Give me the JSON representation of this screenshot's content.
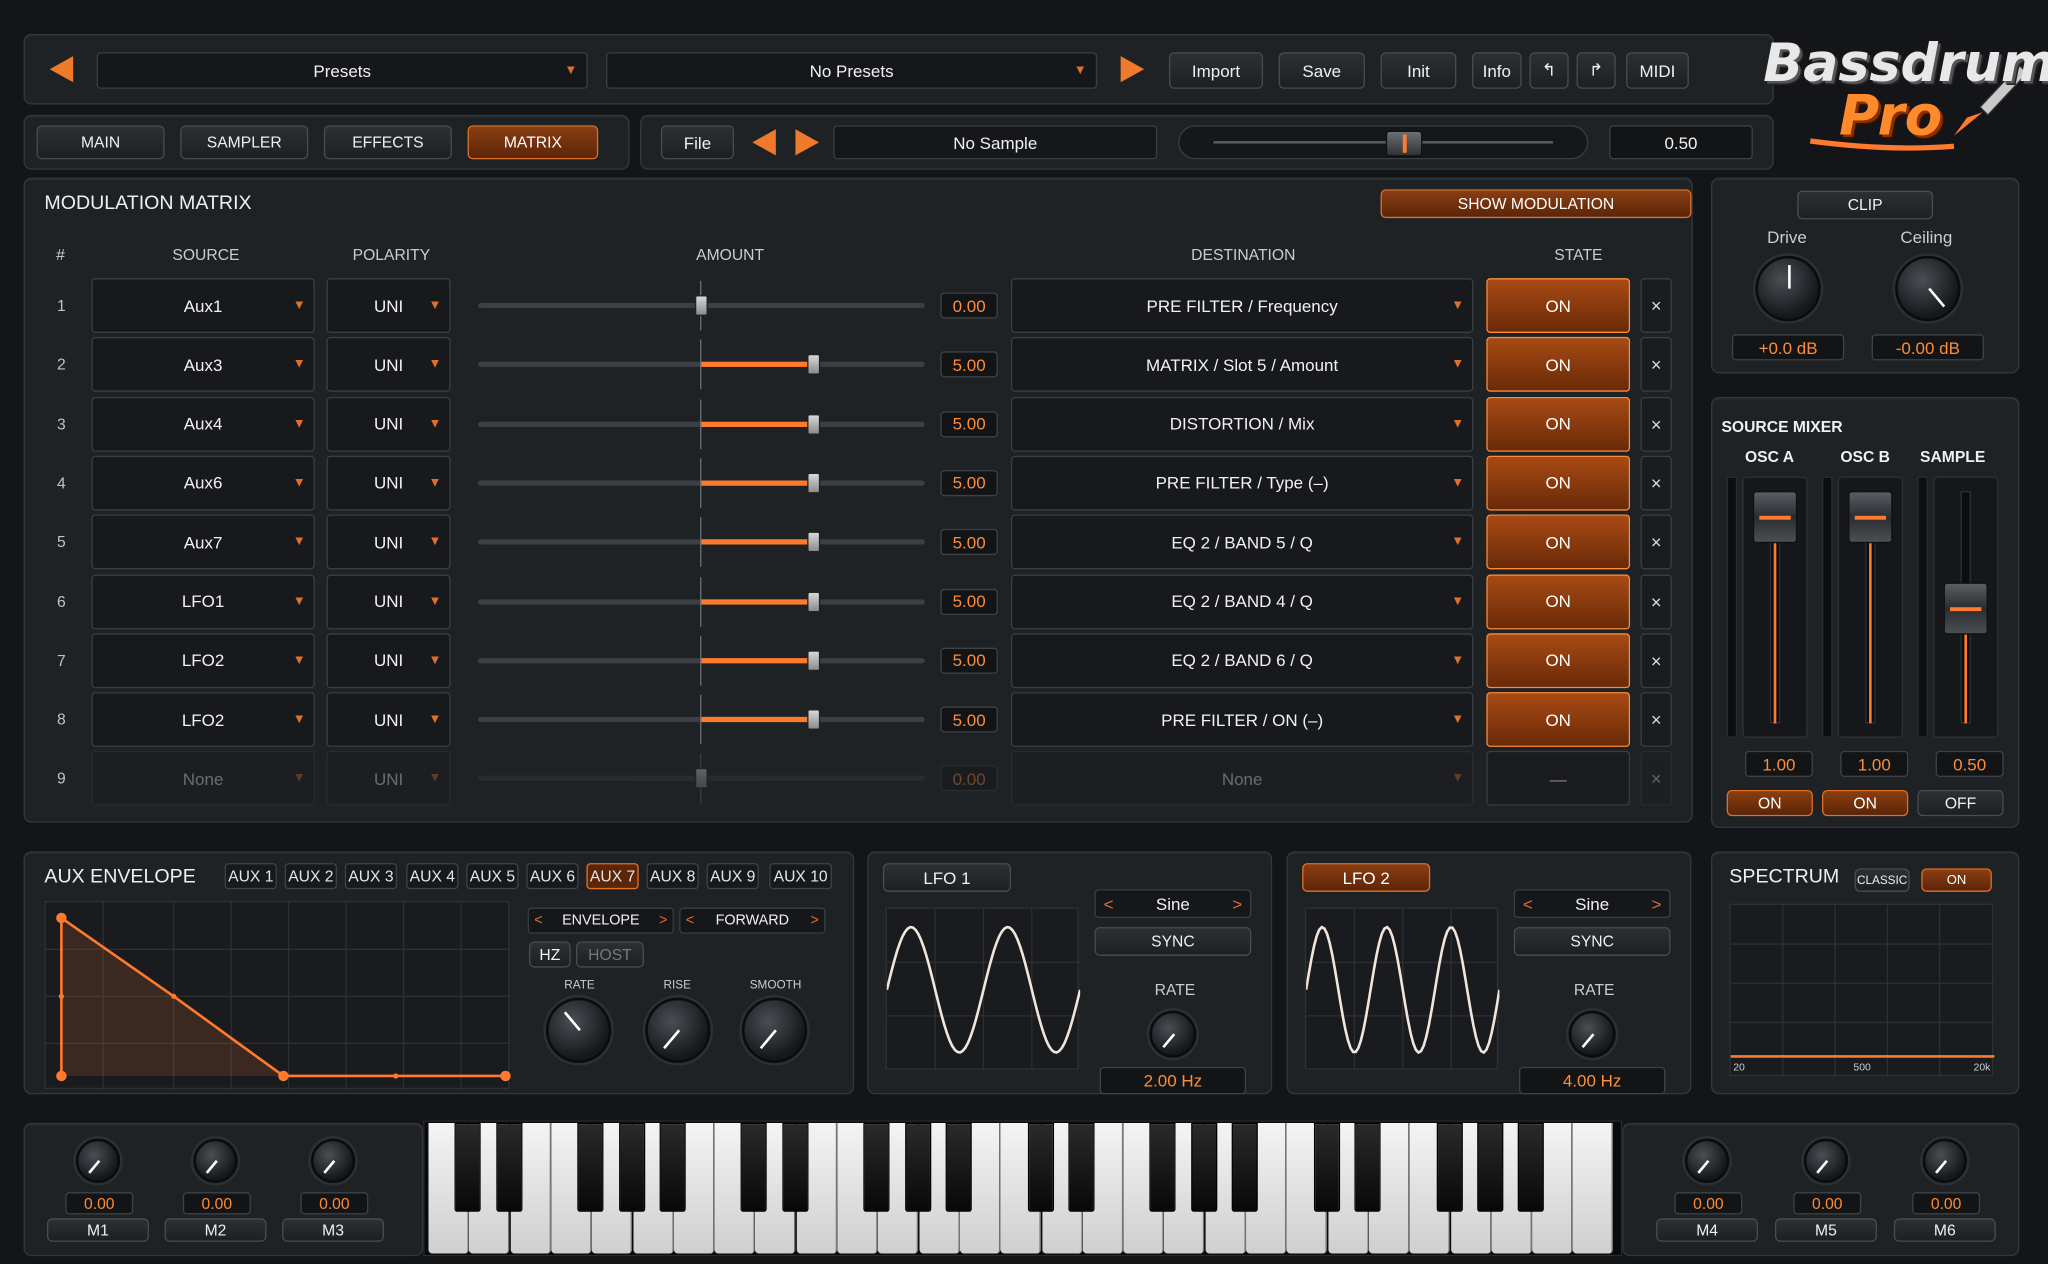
{
  "colors": {
    "accent": "#ff7a2c",
    "panel": "#1f2225",
    "background": "#131518"
  },
  "topbar": {
    "presets_dropdown": "Presets",
    "presets_list": "No Presets",
    "import": "Import",
    "save": "Save",
    "init": "Init",
    "info": "Info",
    "undo_icon": "↰",
    "redo_icon": "↱",
    "midi": "MIDI"
  },
  "logo": {
    "line1": "Bassdrum",
    "line2": "Pro"
  },
  "tabs": [
    "MAIN",
    "SAMPLER",
    "EFFECTS",
    "MATRIX"
  ],
  "active_tab": "MATRIX",
  "sample_bar": {
    "file": "File",
    "sample_name": "No Sample",
    "value": "0.50",
    "slider_value": 0.5
  },
  "matrix": {
    "title": "MODULATION MATRIX",
    "show_modulation": "SHOW MODULATION",
    "headers": {
      "num": "#",
      "source": "SOURCE",
      "polarity": "POLARITY",
      "amount": "AMOUNT",
      "destination": "DESTINATION",
      "state": "STATE"
    },
    "close_icon": "×",
    "rows": [
      {
        "num": "1",
        "source": "Aux1",
        "polarity": "UNI",
        "amount": "0.00",
        "amount_value": 0.0,
        "destination": "PRE FILTER / Frequency",
        "state": "ON"
      },
      {
        "num": "2",
        "source": "Aux3",
        "polarity": "UNI",
        "amount": "5.00",
        "amount_value": 5.0,
        "destination": "MATRIX / Slot 5 / Amount",
        "state": "ON"
      },
      {
        "num": "3",
        "source": "Aux4",
        "polarity": "UNI",
        "amount": "5.00",
        "amount_value": 5.0,
        "destination": "DISTORTION / Mix",
        "state": "ON"
      },
      {
        "num": "4",
        "source": "Aux6",
        "polarity": "UNI",
        "amount": "5.00",
        "amount_value": 5.0,
        "destination": "PRE FILTER / Type (–)",
        "state": "ON"
      },
      {
        "num": "5",
        "source": "Aux7",
        "polarity": "UNI",
        "amount": "5.00",
        "amount_value": 5.0,
        "destination": "EQ 2 / BAND 5 / Q",
        "state": "ON"
      },
      {
        "num": "6",
        "source": "LFO1",
        "polarity": "UNI",
        "amount": "5.00",
        "amount_value": 5.0,
        "destination": "EQ 2 / BAND 4 / Q",
        "state": "ON"
      },
      {
        "num": "7",
        "source": "LFO2",
        "polarity": "UNI",
        "amount": "5.00",
        "amount_value": 5.0,
        "destination": "EQ 2 / BAND 6 / Q",
        "state": "ON"
      },
      {
        "num": "8",
        "source": "LFO2",
        "polarity": "UNI",
        "amount": "5.00",
        "amount_value": 5.0,
        "destination": "PRE FILTER / ON (–)",
        "state": "ON"
      },
      {
        "num": "9",
        "source": "None",
        "polarity": "UNI",
        "amount": "0.00",
        "amount_value": 0.0,
        "destination": "None",
        "state": "—"
      }
    ]
  },
  "clip": {
    "title": "CLIP",
    "drive_label": "Drive",
    "ceiling_label": "Ceiling",
    "drive_value": "+0.0 dB",
    "ceiling_value": "-0.00 dB"
  },
  "source_mixer": {
    "title": "SOURCE MIXER",
    "channels": [
      {
        "name": "OSC A",
        "value": "1.00",
        "level": 1.0,
        "state": "ON"
      },
      {
        "name": "OSC B",
        "value": "1.00",
        "level": 1.0,
        "state": "ON"
      },
      {
        "name": "SAMPLE",
        "value": "0.50",
        "level": 0.5,
        "state": "OFF"
      }
    ]
  },
  "aux_envelope": {
    "title": "AUX ENVELOPE",
    "tabs": [
      "AUX 1",
      "AUX 2",
      "AUX 3",
      "AUX 4",
      "AUX 5",
      "AUX 6",
      "AUX 7",
      "AUX 8",
      "AUX 9",
      "AUX 10"
    ],
    "active_tab": "AUX 7",
    "mode": "ENVELOPE",
    "direction": "FORWARD",
    "hz": "HZ",
    "host": "HOST",
    "rate_label": "RATE",
    "rise_label": "RISE",
    "smooth_label": "SMOOTH",
    "arrow_left": "<",
    "arrow_right": ">"
  },
  "lfo1": {
    "title": "LFO 1",
    "shape": "Sine",
    "sync": "SYNC",
    "rate_label": "RATE",
    "rate_value": "2.00 Hz"
  },
  "lfo2": {
    "title": "LFO 2",
    "shape": "Sine",
    "sync": "SYNC",
    "rate_label": "RATE",
    "rate_value": "4.00 Hz"
  },
  "spectrum": {
    "title": "SPECTRUM",
    "classic": "CLASSIC",
    "on": "ON",
    "ticks": [
      "20",
      "500",
      "20k"
    ]
  },
  "macros": {
    "left": [
      {
        "name": "M1",
        "value": "0.00"
      },
      {
        "name": "M2",
        "value": "0.00"
      },
      {
        "name": "M3",
        "value": "0.00"
      }
    ],
    "right": [
      {
        "name": "M4",
        "value": "0.00"
      },
      {
        "name": "M5",
        "value": "0.00"
      },
      {
        "name": "M6",
        "value": "0.00"
      }
    ]
  }
}
